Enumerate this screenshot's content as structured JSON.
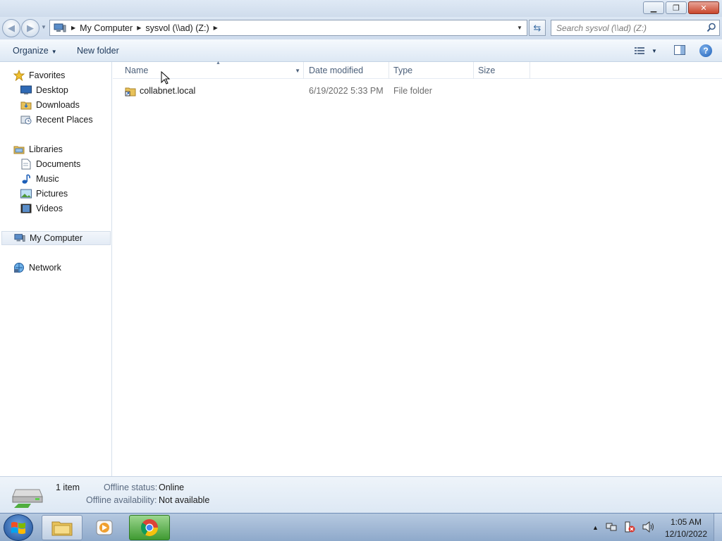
{
  "window": {
    "minimize": "▭",
    "maximize": "❐",
    "close": "✕"
  },
  "address": {
    "crumbs": [
      "My Computer",
      "sysvol (\\\\ad) (Z:)"
    ],
    "icon": "computer-icon"
  },
  "search": {
    "placeholder": "Search sysvol (\\\\ad) (Z:)"
  },
  "toolbar": {
    "organize": "Organize",
    "new_folder": "New folder"
  },
  "nav": {
    "favorites": "Favorites",
    "desktop": "Desktop",
    "downloads": "Downloads",
    "recent_places": "Recent Places",
    "libraries": "Libraries",
    "documents": "Documents",
    "music": "Music",
    "pictures": "Pictures",
    "videos": "Videos",
    "my_computer": "My Computer",
    "network": "Network"
  },
  "columns": {
    "name": "Name",
    "date_modified": "Date modified",
    "type": "Type",
    "size": "Size"
  },
  "files": [
    {
      "name": "collabnet.local",
      "date_modified": "6/19/2022 5:33 PM",
      "type": "File folder",
      "size": "",
      "icon": "folder-shortcut-icon"
    }
  ],
  "details": {
    "count": "1 item",
    "offline_status_label": "Offline status:",
    "offline_status_value": "Online",
    "offline_availability_label": "Offline availability:",
    "offline_availability_value": "Not available"
  },
  "taskbar": {
    "time": "1:05 AM",
    "date": "12/10/2022"
  }
}
